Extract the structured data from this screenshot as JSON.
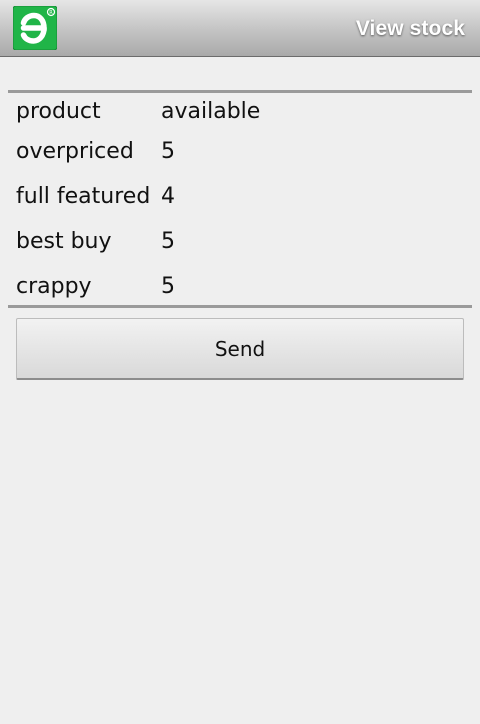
{
  "action_bar": {
    "title": "View stock",
    "logo_icon": "app-logo-icon",
    "logo_color": "#20b548"
  },
  "table": {
    "headers": {
      "product": "product",
      "available": "available"
    },
    "rows": [
      {
        "product": "overpriced",
        "available": "5"
      },
      {
        "product": "full featured",
        "available": "4"
      },
      {
        "product": "best buy",
        "available": "5"
      },
      {
        "product": "crappy",
        "available": "5"
      }
    ]
  },
  "send_button": {
    "label": "Send"
  }
}
